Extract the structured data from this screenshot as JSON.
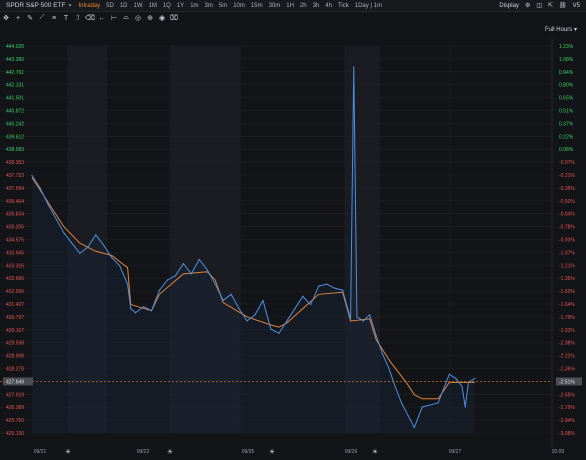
{
  "topbar": {
    "symbol_title": "SPDR S&P 500 ETF",
    "timeframes": [
      "Intraday",
      "5D",
      "1D",
      "1W",
      "1M",
      "1Q",
      "1Y",
      "1m",
      "3m",
      "5m",
      "10m",
      "15m",
      "30m",
      "1H",
      "2h",
      "3h",
      "4h",
      "Tick",
      "1Day | 1m"
    ],
    "active_timeframe": "Intraday",
    "display_label": "Display",
    "version_label": "V5"
  },
  "toolbar": {
    "icons": [
      "move-icon",
      "crosshair-icon",
      "pen-icon",
      "trendline-icon",
      "fibonacci-icon",
      "text-icon",
      "brush-icon",
      "eraser-icon",
      "arrow-left-icon",
      "ruler-icon",
      "shapes-icon",
      "circle-icon",
      "lock-icon",
      "eye-icon",
      "trash-icon"
    ]
  },
  "full_hours_label": "Full Hours",
  "colors": {
    "price_line": "#4d8fe0",
    "moving_average": "#e0843a",
    "reference_line": "#e07a2a",
    "axis_up": "#3ccf6b",
    "axis_down": "#e25555",
    "axis_neutral": "#aab0b8",
    "current_badge": "#4a4d54"
  },
  "chart_data": {
    "type": "line",
    "y_axis_prices": [
      "444.020",
      "443.390",
      "442.761",
      "442.131",
      "441.501",
      "440.872",
      "440.242",
      "439.612",
      "438.983",
      "438.353",
      "437.723",
      "437.094",
      "436.464",
      "435.834",
      "435.205",
      "434.575",
      "433.945",
      "433.316",
      "432.686",
      "432.056",
      "431.427",
      "430.797",
      "430.167",
      "429.538",
      "428.908",
      "428.278",
      "427.649",
      "427.019",
      "426.389",
      "425.760",
      "425.130"
    ],
    "y_axis_percent": [
      "1.23%",
      "1.08%",
      "0.94%",
      "0.80%",
      "0.65%",
      "0.51%",
      "0.37%",
      "0.22%",
      "0.08%",
      "-0.07%",
      "-0.21%",
      "-0.35%",
      "-0.50%",
      "-0.64%",
      "-0.78%",
      "-0.93%",
      "-1.07%",
      "-1.21%",
      "-1.36%",
      "-1.50%",
      "-1.64%",
      "-1.79%",
      "-1.93%",
      "-2.08%",
      "-2.22%",
      "-2.36%",
      "-2.51%",
      "-2.65%",
      "-2.79%",
      "-2.94%",
      "-3.08%"
    ],
    "reference_price": "427.649",
    "reference_percent": "-2.51%",
    "x_axis_labels": [
      "09/21",
      "09/22",
      "09/25",
      "09/26",
      "09/27",
      "20:00"
    ],
    "price_series": [
      {
        "t": 0,
        "p": 437.7
      },
      {
        "t": 5,
        "p": 437.1
      },
      {
        "t": 10,
        "p": 436.3
      },
      {
        "t": 15,
        "p": 435.6
      },
      {
        "t": 20,
        "p": 434.9
      },
      {
        "t": 25,
        "p": 434.4
      },
      {
        "t": 30,
        "p": 433.9
      },
      {
        "t": 35,
        "p": 434.2
      },
      {
        "t": 40,
        "p": 434.8
      },
      {
        "t": 45,
        "p": 434.3
      },
      {
        "t": 50,
        "p": 433.7
      },
      {
        "t": 55,
        "p": 433.3
      },
      {
        "t": 60,
        "p": 432.4
      },
      {
        "t": 62,
        "p": 431.2
      },
      {
        "t": 65,
        "p": 431.0
      },
      {
        "t": 70,
        "p": 431.3
      },
      {
        "t": 75,
        "p": 431.1
      },
      {
        "t": 80,
        "p": 432.1
      },
      {
        "t": 85,
        "p": 432.6
      },
      {
        "t": 90,
        "p": 432.8
      },
      {
        "t": 95,
        "p": 433.4
      },
      {
        "t": 100,
        "p": 432.9
      },
      {
        "t": 105,
        "p": 433.6
      },
      {
        "t": 110,
        "p": 433.1
      },
      {
        "t": 115,
        "p": 432.4
      },
      {
        "t": 120,
        "p": 431.6
      },
      {
        "t": 125,
        "p": 431.9
      },
      {
        "t": 130,
        "p": 431.2
      },
      {
        "t": 135,
        "p": 430.6
      },
      {
        "t": 140,
        "p": 430.9
      },
      {
        "t": 145,
        "p": 431.6
      },
      {
        "t": 150,
        "p": 430.2
      },
      {
        "t": 155,
        "p": 430.0
      },
      {
        "t": 160,
        "p": 430.6
      },
      {
        "t": 165,
        "p": 431.2
      },
      {
        "t": 170,
        "p": 431.8
      },
      {
        "t": 175,
        "p": 431.4
      },
      {
        "t": 180,
        "p": 432.3
      },
      {
        "t": 185,
        "p": 432.4
      },
      {
        "t": 190,
        "p": 432.2
      },
      {
        "t": 195,
        "p": 432.1
      },
      {
        "t": 200,
        "p": 430.7
      },
      {
        "t": 202,
        "p": 443.0
      },
      {
        "t": 204,
        "p": 430.8
      },
      {
        "t": 208,
        "p": 430.6
      },
      {
        "t": 212,
        "p": 430.9
      },
      {
        "t": 216,
        "p": 429.9
      },
      {
        "t": 220,
        "p": 429.0
      },
      {
        "t": 224,
        "p": 428.3
      },
      {
        "t": 228,
        "p": 427.4
      },
      {
        "t": 232,
        "p": 426.6
      },
      {
        "t": 236,
        "p": 426.0
      },
      {
        "t": 240,
        "p": 425.4
      },
      {
        "t": 245,
        "p": 426.4
      },
      {
        "t": 250,
        "p": 426.5
      },
      {
        "t": 255,
        "p": 426.6
      },
      {
        "t": 262,
        "p": 428.0
      },
      {
        "t": 266,
        "p": 427.8
      },
      {
        "t": 270,
        "p": 427.4
      },
      {
        "t": 272,
        "p": 426.4
      },
      {
        "t": 274,
        "p": 427.6
      },
      {
        "t": 278,
        "p": 427.8
      }
    ],
    "ma_series": [
      {
        "t": 0,
        "p": 437.6
      },
      {
        "t": 10,
        "p": 436.4
      },
      {
        "t": 20,
        "p": 435.2
      },
      {
        "t": 30,
        "p": 434.4
      },
      {
        "t": 40,
        "p": 434.0
      },
      {
        "t": 50,
        "p": 433.8
      },
      {
        "t": 60,
        "p": 433.2
      },
      {
        "t": 62,
        "p": 431.4
      },
      {
        "t": 75,
        "p": 431.1
      },
      {
        "t": 80,
        "p": 431.9
      },
      {
        "t": 95,
        "p": 432.9
      },
      {
        "t": 110,
        "p": 433.0
      },
      {
        "t": 115,
        "p": 432.6
      },
      {
        "t": 120,
        "p": 431.5
      },
      {
        "t": 135,
        "p": 430.8
      },
      {
        "t": 150,
        "p": 430.4
      },
      {
        "t": 155,
        "p": 430.3
      },
      {
        "t": 160,
        "p": 430.5
      },
      {
        "t": 170,
        "p": 431.2
      },
      {
        "t": 180,
        "p": 431.9
      },
      {
        "t": 195,
        "p": 432.0
      },
      {
        "t": 200,
        "p": 430.6
      },
      {
        "t": 212,
        "p": 430.7
      },
      {
        "t": 216,
        "p": 429.7
      },
      {
        "t": 225,
        "p": 428.6
      },
      {
        "t": 235,
        "p": 427.6
      },
      {
        "t": 240,
        "p": 427.0
      },
      {
        "t": 245,
        "p": 426.8
      },
      {
        "t": 255,
        "p": 426.8
      },
      {
        "t": 262,
        "p": 427.6
      },
      {
        "t": 278,
        "p": 427.6
      }
    ]
  }
}
